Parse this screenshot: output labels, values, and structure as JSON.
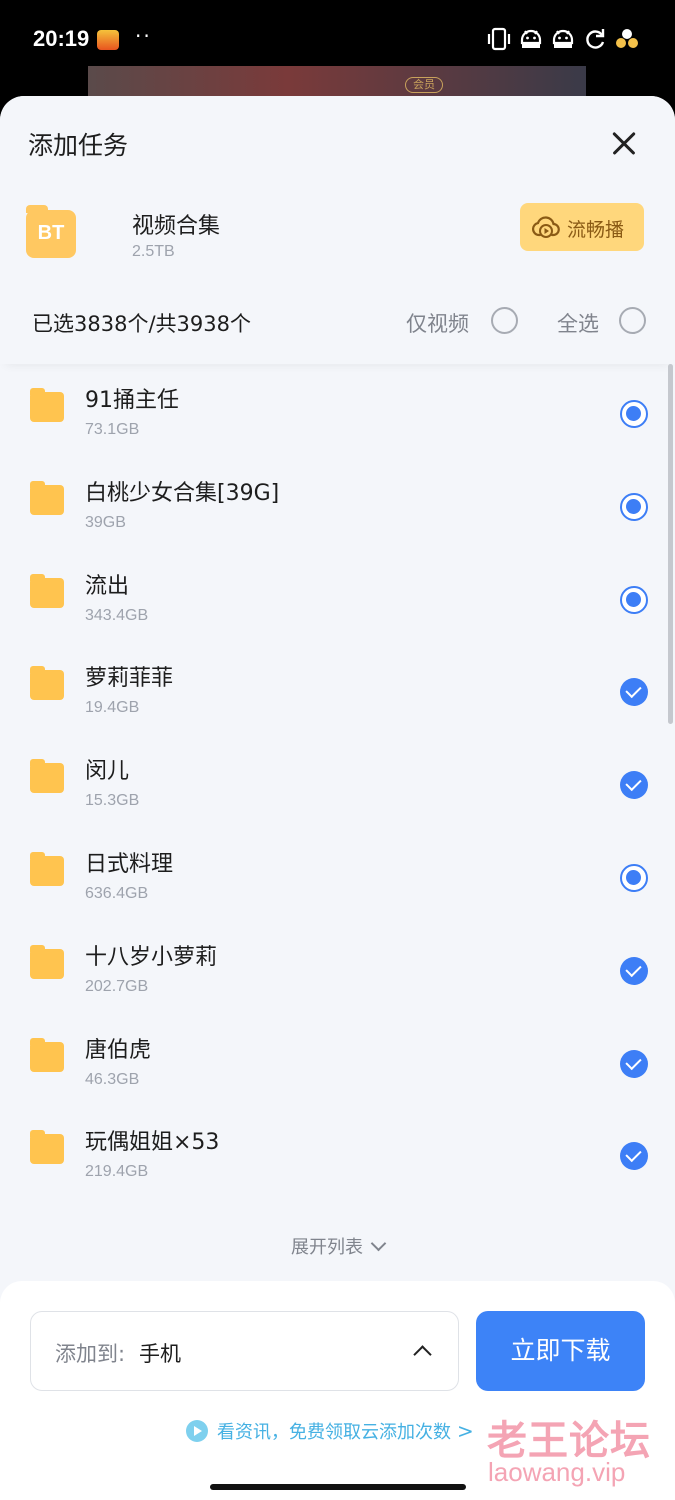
{
  "status_bar": {
    "time": "20:19",
    "dots": "··"
  },
  "background": {
    "badge": "会员"
  },
  "sheet": {
    "title": "添加任务",
    "torrent": {
      "icon_text": "BT",
      "name": "视频合集",
      "size": "2.5TB"
    },
    "stream_button": "流畅播",
    "selection": {
      "count_text": "已选3838个/共3938个",
      "video_only": "仅视频",
      "select_all": "全选"
    }
  },
  "files": [
    {
      "name": "91捅主任",
      "size": "73.1GB",
      "state": "radio"
    },
    {
      "name": "白桃少女合集[39G]",
      "size": "39GB",
      "state": "radio"
    },
    {
      "name": "流出",
      "size": "343.4GB",
      "state": "radio"
    },
    {
      "name": "萝莉菲菲",
      "size": "19.4GB",
      "state": "check"
    },
    {
      "name": "闵儿",
      "size": "15.3GB",
      "state": "check"
    },
    {
      "name": "日式料理",
      "size": "636.4GB",
      "state": "radio"
    },
    {
      "name": "十八岁小萝莉",
      "size": "202.7GB",
      "state": "check"
    },
    {
      "name": "唐伯虎",
      "size": "46.3GB",
      "state": "check"
    },
    {
      "name": "玩偶姐姐×53",
      "size": "219.4GB",
      "state": "check"
    }
  ],
  "expand_label": "展开列表",
  "footer": {
    "dest_prefix": "添加到:",
    "dest_value": "手机",
    "download_button": "立即下载",
    "promo_text": "看资讯，免费领取云添加次数",
    "promo_arrow": ">"
  },
  "watermark": {
    "cn": "老王论坛",
    "en": "laowang.vip"
  },
  "colors": {
    "accent": "#3d7ef6",
    "folder": "#ffc44f",
    "stream_bg": "#ffd77c",
    "promo": "#46b1e3",
    "watermark": "#f4a4b4"
  }
}
